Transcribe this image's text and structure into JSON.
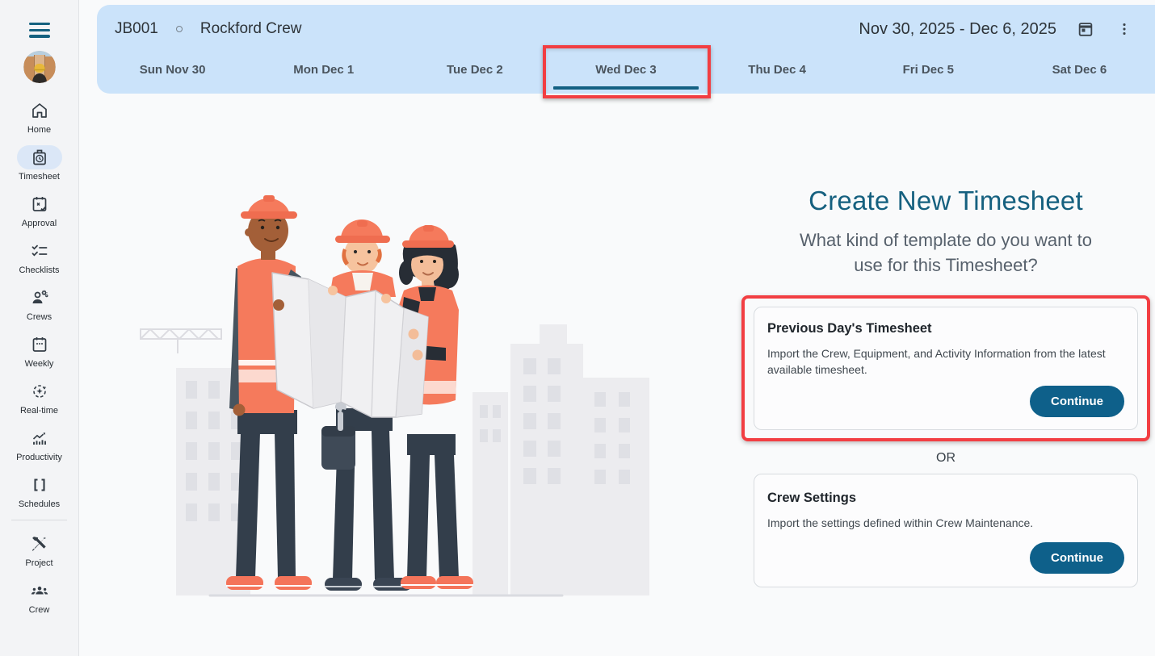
{
  "colors": {
    "accent_teal": "#136183",
    "header_blue": "#cbe3fa",
    "annotation_red": "#f23e42",
    "button_teal": "#0e608a",
    "sidebar_bg": "#f3f4f6"
  },
  "sidebar": {
    "items": [
      {
        "label": "Home",
        "icon": "home-icon"
      },
      {
        "label": "Timesheet",
        "icon": "punch-clock-icon",
        "active": true
      },
      {
        "label": "Approval",
        "icon": "calendar-approval-icon"
      },
      {
        "label": "Checklists",
        "icon": "checklist-icon"
      },
      {
        "label": "Crews",
        "icon": "person-gear-icon"
      },
      {
        "label": "Weekly",
        "icon": "calendar-week-icon"
      },
      {
        "label": "Real-time",
        "icon": "realtime-sync-icon"
      },
      {
        "label": "Productivity",
        "icon": "trend-chart-icon"
      },
      {
        "label": "Schedules",
        "icon": "brackets-icon"
      },
      {
        "label": "Project",
        "icon": "tools-icon"
      },
      {
        "label": "Crew",
        "icon": "people-group-icon"
      }
    ]
  },
  "header": {
    "job_code": "JB001",
    "crew_name": "Rockford Crew",
    "date_range": "Nov 30, 2025 - Dec 6, 2025"
  },
  "tabs": [
    {
      "label": "Sun Nov 30"
    },
    {
      "label": "Mon Dec 1"
    },
    {
      "label": "Tue Dec 2"
    },
    {
      "label": "Wed Dec 3",
      "active": true,
      "annotated": true
    },
    {
      "label": "Thu Dec 4"
    },
    {
      "label": "Fri Dec 5"
    },
    {
      "label": "Sat Dec 6"
    }
  ],
  "panel": {
    "title": "Create New Timesheet",
    "subtitle": "What kind of template do you want to use for this Timesheet?",
    "or_label": "OR",
    "cards": [
      {
        "title": "Previous Day's Timesheet",
        "description": "Import the Crew, Equipment, and Activity Information from the latest available timesheet.",
        "button_label": "Continue",
        "annotated": true
      },
      {
        "title": "Crew Settings",
        "description": "Import the settings defined within Crew Maintenance.",
        "button_label": "Continue",
        "annotated": false
      }
    ]
  }
}
